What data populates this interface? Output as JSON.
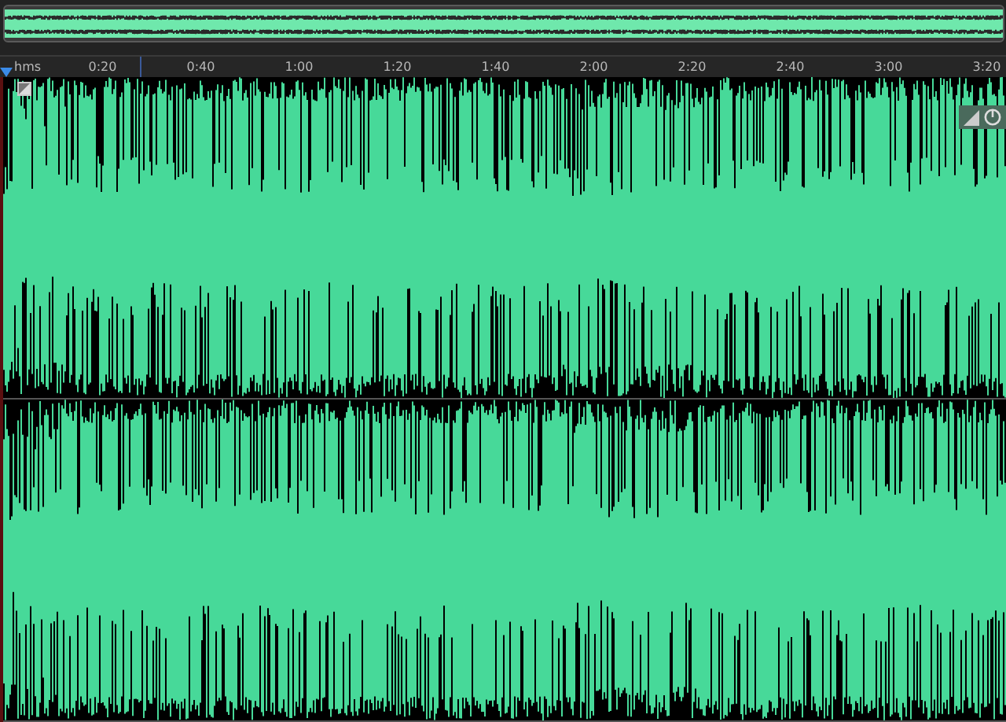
{
  "ruler": {
    "unit": "hms",
    "ticks": [
      "0:20",
      "0:40",
      "1:00",
      "1:20",
      "1:40",
      "2:00",
      "2:20",
      "2:40",
      "3:00",
      "3:20"
    ]
  },
  "channels": [
    {
      "kind": "waveform"
    },
    {
      "kind": "waveform"
    }
  ]
}
